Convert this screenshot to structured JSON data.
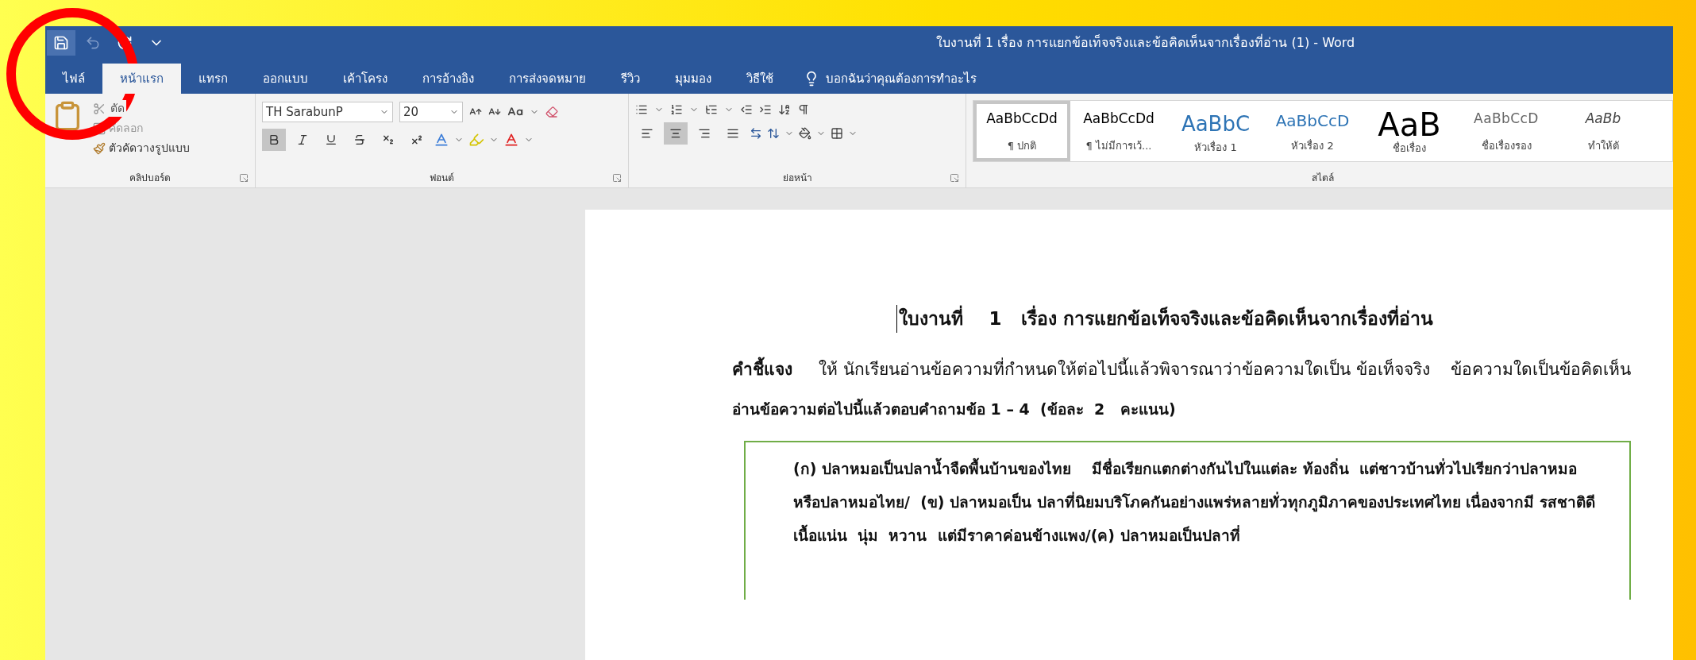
{
  "window": {
    "title": "ใบงานที่ 1 เรื่อง การแยกข้อเท็จจริงและข้อคิดเห็นจากเรื่องที่อ่าน (1)  -  Word"
  },
  "quick_access": [
    {
      "kind": "save",
      "disabled": false
    },
    {
      "kind": "undo",
      "disabled": true
    },
    {
      "kind": "redo",
      "disabled": false
    },
    {
      "kind": "customize",
      "disabled": false
    }
  ],
  "tabs": [
    {
      "label": "ไฟล์",
      "selected": false
    },
    {
      "label": "หน้าแรก",
      "selected": true
    },
    {
      "label": "แทรก",
      "selected": false
    },
    {
      "label": "ออกแบบ",
      "selected": false
    },
    {
      "label": "เค้าโครง",
      "selected": false
    },
    {
      "label": "การอ้างอิง",
      "selected": false
    },
    {
      "label": "การส่งจดหมาย",
      "selected": false
    },
    {
      "label": "รีวิว",
      "selected": false
    },
    {
      "label": "มุมมอง",
      "selected": false
    },
    {
      "label": "วิธีใช้",
      "selected": false
    }
  ],
  "tell_me": "บอกฉันว่าคุณต้องการทำอะไร",
  "clipboard": {
    "cut": "ตัด",
    "copy": "คัดลอก",
    "format_painter": "ตัวคัดวางรูปแบบ",
    "label": "คลิปบอร์ด"
  },
  "font": {
    "name": "TH SarabunP",
    "size": "20",
    "label": "ฟอนต์",
    "format_buttons": [
      {
        "kind": "bold",
        "selected": true
      },
      {
        "kind": "italic",
        "selected": false
      },
      {
        "kind": "underline",
        "selected": false
      },
      {
        "kind": "strike",
        "selected": false
      },
      {
        "kind": "subscript",
        "selected": false
      },
      {
        "kind": "superscript",
        "selected": false
      }
    ]
  },
  "paragraph": {
    "label": "ย่อหน้า",
    "align_buttons": [
      {
        "kind": "left",
        "selected": false
      },
      {
        "kind": "center",
        "selected": true
      },
      {
        "kind": "right",
        "selected": false
      },
      {
        "kind": "justify",
        "selected": false
      }
    ]
  },
  "styles": {
    "label": "สไตล์",
    "items": [
      {
        "preview": "AaBbCcDd",
        "name": "¶ ปกติ",
        "kind": "normal",
        "selected": true
      },
      {
        "preview": "AaBbCcDd",
        "name": "¶ ไม่มีการเว้...",
        "kind": "normal",
        "selected": false
      },
      {
        "preview": "AaBbC",
        "name": "หัวเรื่อง 1",
        "kind": "heading1",
        "selected": false
      },
      {
        "preview": "AaBbCcD",
        "name": "หัวเรื่อง 2",
        "kind": "heading2",
        "selected": false
      },
      {
        "preview": "AaB",
        "name": "ชื่อเรื่อง",
        "kind": "title",
        "selected": false
      },
      {
        "preview": "AaBbCcD",
        "name": "ชื่อเรื่องรอง",
        "kind": "subtitle",
        "selected": false
      },
      {
        "preview": "AaBb",
        "name": "ทำให้ตั",
        "kind": "emphasis",
        "selected": false
      }
    ]
  },
  "document": {
    "title": "ใบงานที่    1   เรื่อง การแยกข้อเท็จจริงและข้อคิดเห็นจากเรื่องที่อ่าน",
    "instruction": "**คำชี้แจง**     ให้ นักเรียนอ่านข้อความที่กำหนดให้ต่อไปนี้แล้วพิจารณาว่าข้อความใดเป็น ข้อเท็จจริง    ข้อความใดเป็นข้อคิดเห็น",
    "question": "อ่านข้อความต่อไปนี้แล้วตอบคำถามข้อ 1 – 4  (ข้อละ  2   คะแนน)",
    "passage": "(ก) ปลาหมอเป็นปลาน้ำจืดพื้นบ้านของไทย    มีชื่อเรียกแตกต่างกันไปในแต่ละ ท้องถิ่น  แต่ชาวบ้านทั่วไปเรียกว่าปลาหมอหรือปลาหมอไทย/  (ข) ปลาหมอเป็น ปลาที่นิยมบริโภคกันอย่างแพร่หลายทั่วทุกภูมิภาคของประเทศไทย เนื่องจากมี รสชาติดี  เนื้อแน่น  นุ่ม  หวาน  แต่มีราคาค่อนข้างแพง/(ค) ปลาหมอเป็นปลาที่"
  }
}
